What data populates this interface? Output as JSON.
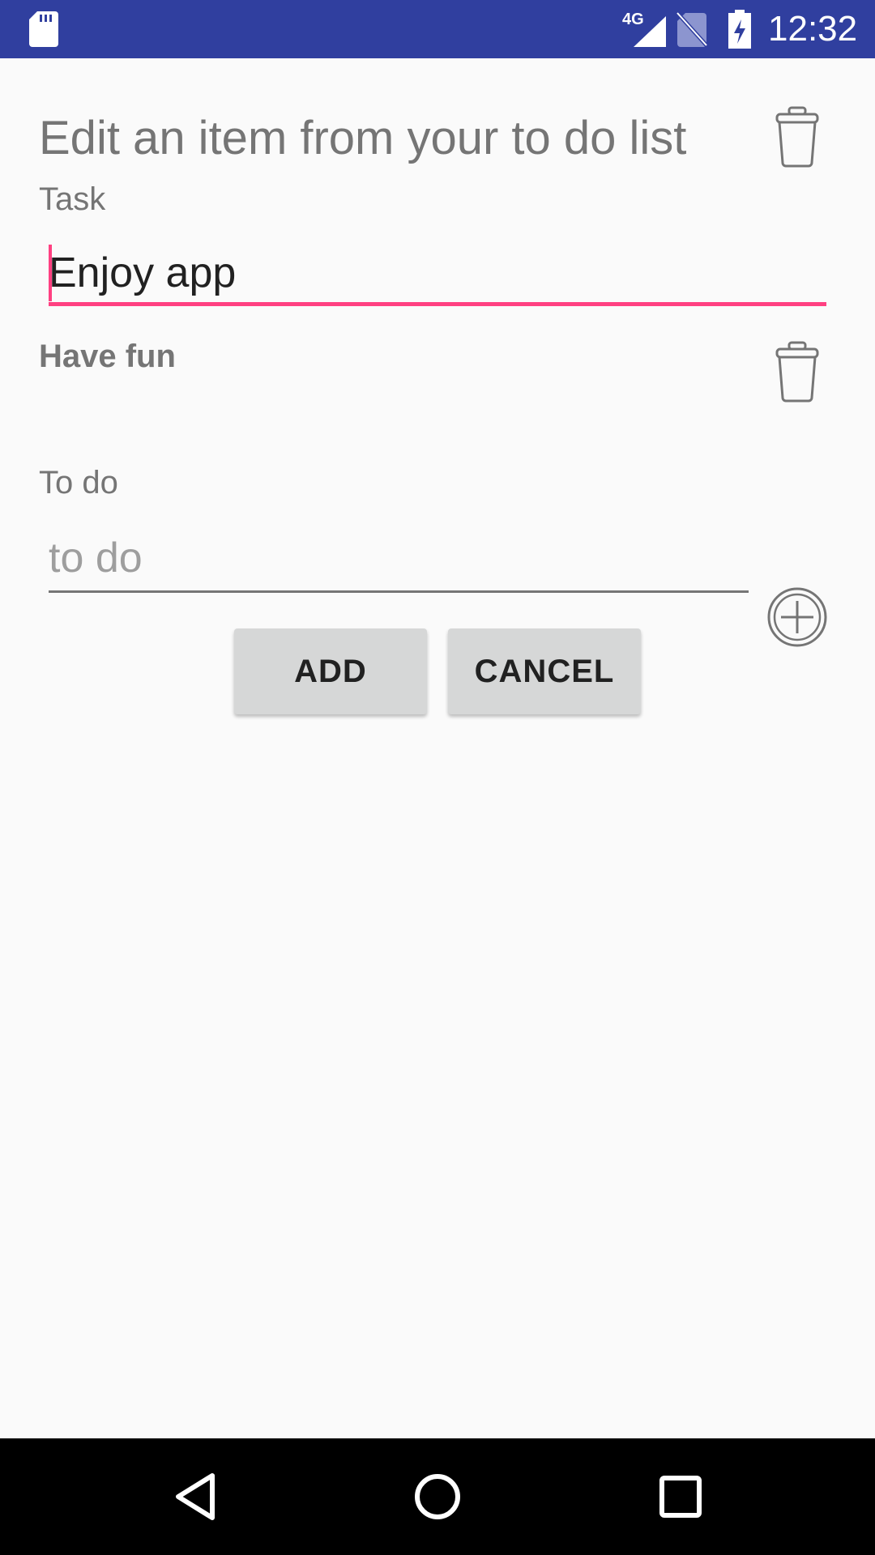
{
  "status_bar": {
    "time": "12:32",
    "network_label": "4G",
    "icons": [
      "sd-card-icon",
      "signal-4g-icon",
      "no-sim-icon",
      "battery-charging-icon"
    ]
  },
  "page": {
    "title": "Edit an item from your to do list"
  },
  "task": {
    "label": "Task",
    "value": "Enjoy app"
  },
  "items": [
    {
      "text": "Have fun"
    }
  ],
  "todo": {
    "label": "To do",
    "placeholder": "to do",
    "value": ""
  },
  "buttons": {
    "add_label": "ADD",
    "cancel_label": "CANCEL"
  },
  "colors": {
    "status_bar": "#303f9f",
    "accent": "#ff4081",
    "background": "#fafafa",
    "button": "#d6d7d7",
    "secondary_text": "#757575"
  },
  "icons": {
    "delete": "trash-icon",
    "add": "add-circle-icon",
    "nav": [
      "back-icon",
      "home-icon",
      "recents-icon"
    ]
  }
}
